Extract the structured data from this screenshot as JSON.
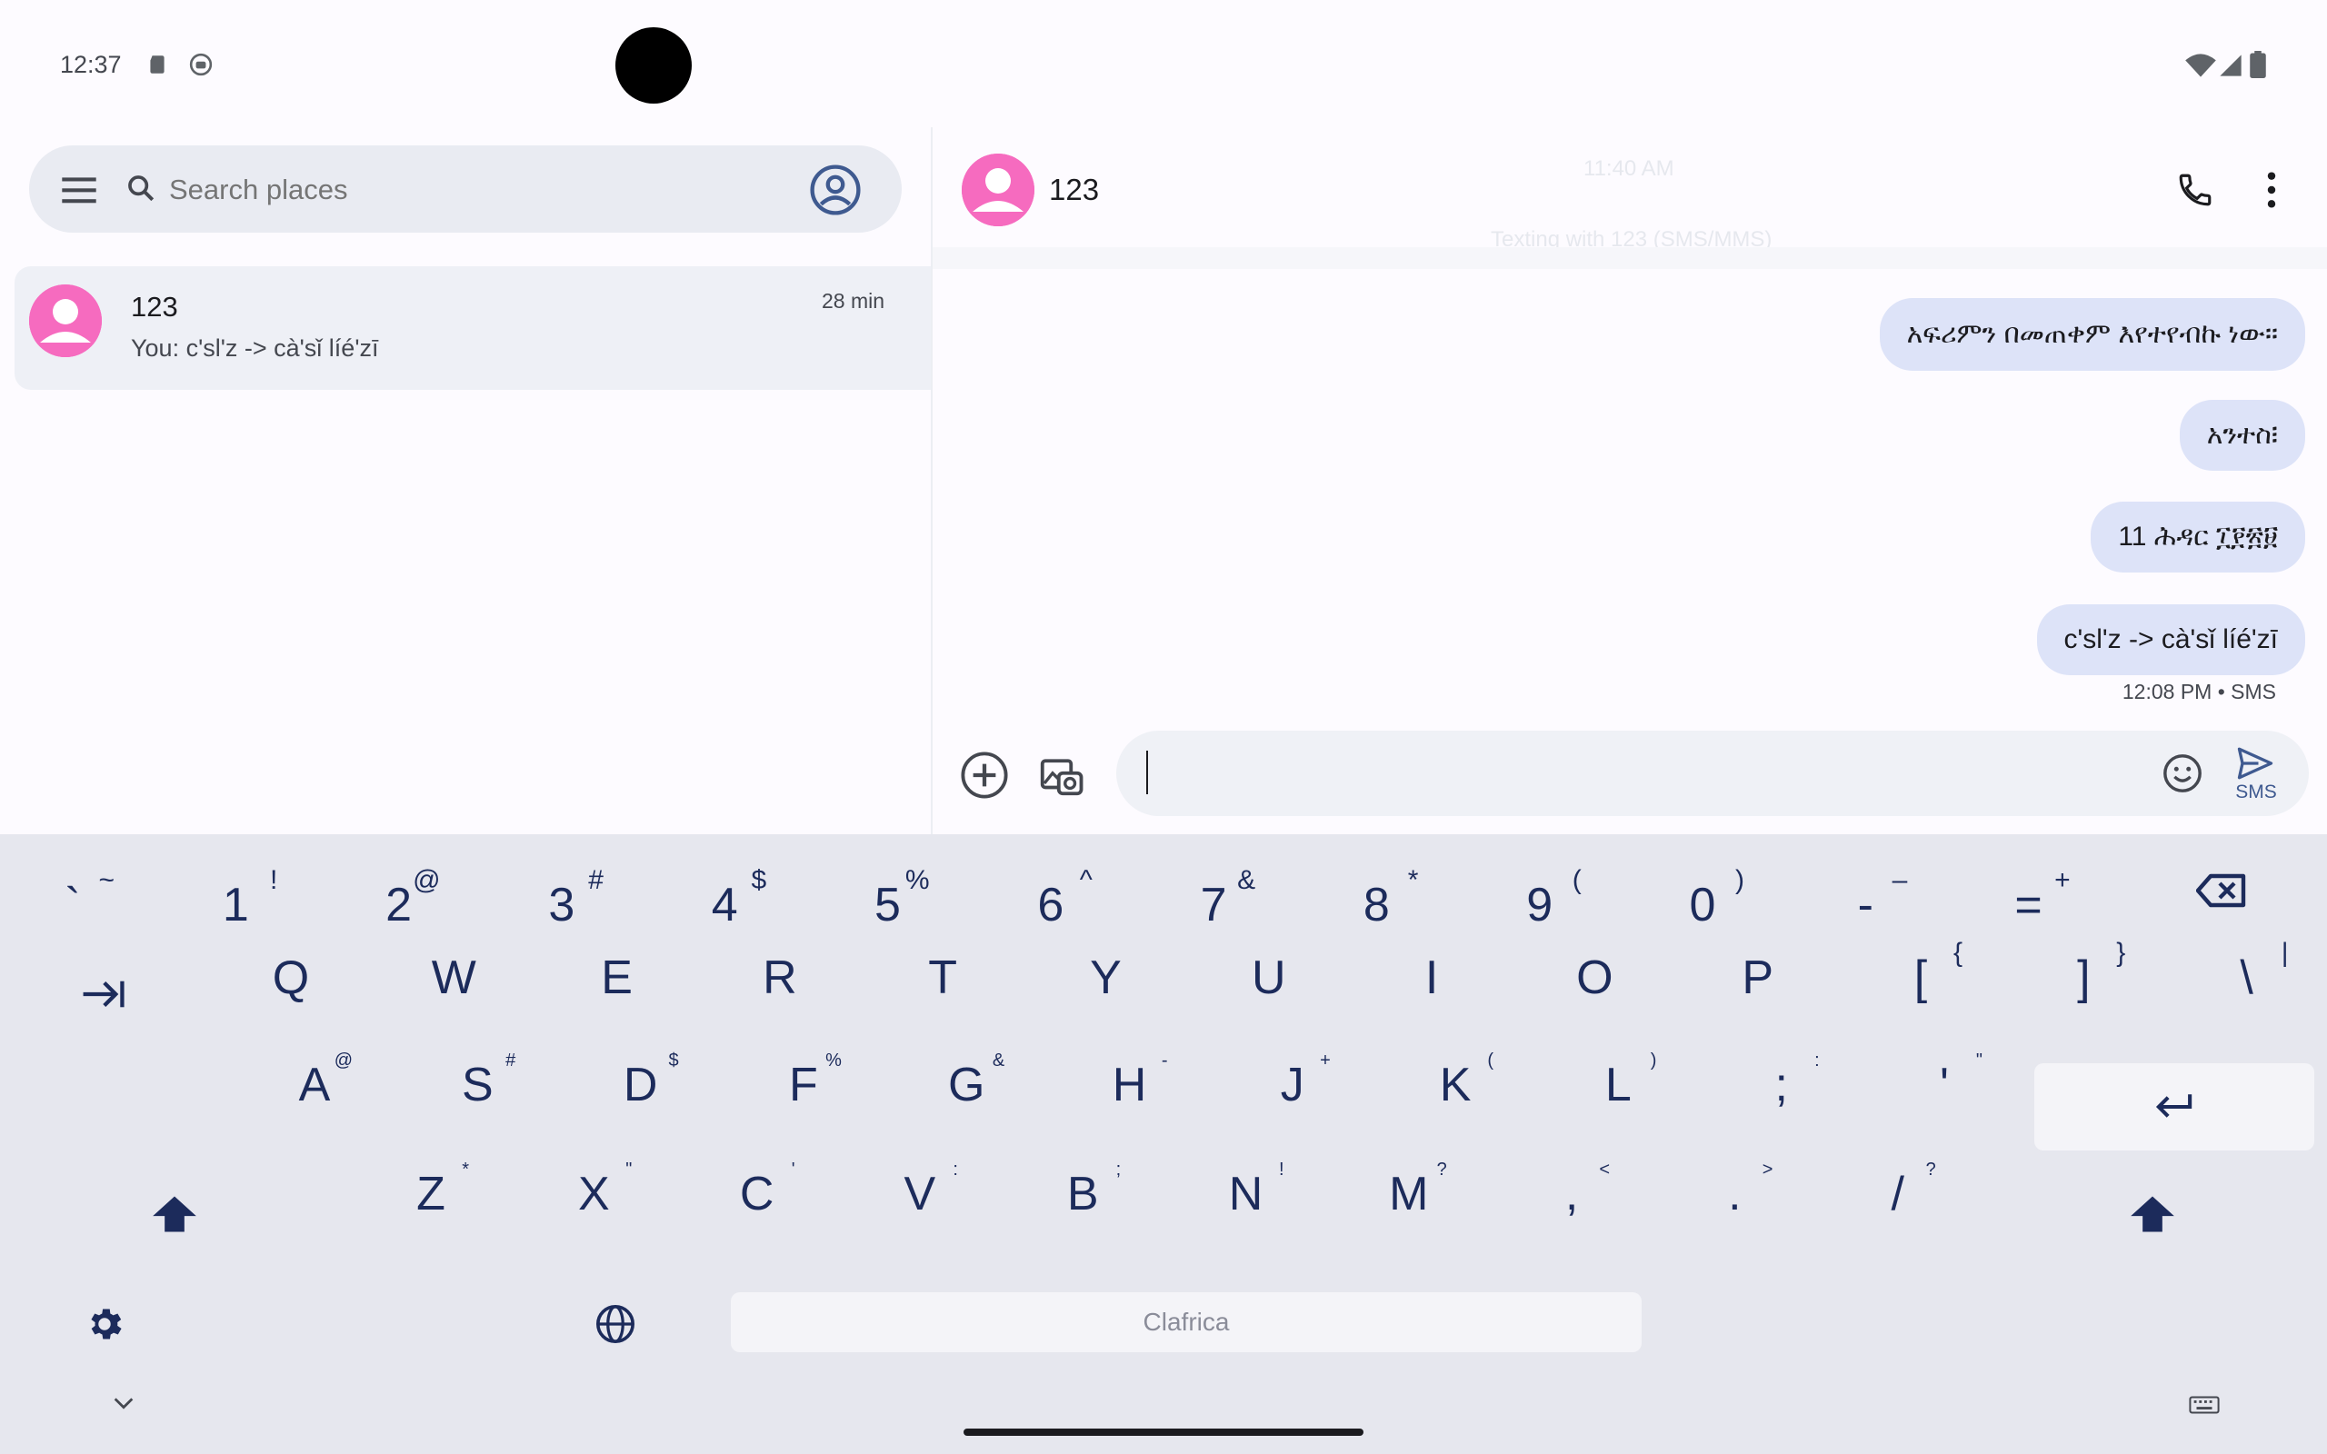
{
  "status_bar": {
    "time": "12:37"
  },
  "search": {
    "placeholder": "Search places"
  },
  "conversations": [
    {
      "name": "123",
      "time": "28 min",
      "snippet": "You: c'sl'z -> cà'sǐ líé'zī"
    }
  ],
  "chat": {
    "contact_name": "123",
    "faint_time": "11:40 AM",
    "faint_info": "Texting with 123 (SMS/MMS)",
    "messages": [
      {
        "text": "አፍሪምን በመጠቀም እየተየብኩ ነው።"
      },
      {
        "text": "አንተስ፧"
      },
      {
        "text": "11 ሕዳር ፲፻፳፱"
      },
      {
        "text": "c'sl'z -> cà'sǐ líé'zī"
      }
    ],
    "last_meta": "12:08 PM • SMS",
    "send_label": "SMS"
  },
  "keyboard": {
    "space_label": "Clafrica",
    "row1": [
      {
        "main": "`",
        "sup": "~"
      },
      {
        "main": "1",
        "sup": "!"
      },
      {
        "main": "2",
        "sup": "@"
      },
      {
        "main": "3",
        "sup": "#"
      },
      {
        "main": "4",
        "sup": "$"
      },
      {
        "main": "5",
        "sup": "%"
      },
      {
        "main": "6",
        "sup": "^"
      },
      {
        "main": "7",
        "sup": "&"
      },
      {
        "main": "8",
        "sup": "*"
      },
      {
        "main": "9",
        "sup": "("
      },
      {
        "main": "0",
        "sup": ")"
      },
      {
        "main": "-",
        "sup": "–"
      },
      {
        "main": "=",
        "sup": "+"
      }
    ],
    "row2": [
      {
        "main": "Q"
      },
      {
        "main": "W"
      },
      {
        "main": "E"
      },
      {
        "main": "R"
      },
      {
        "main": "T"
      },
      {
        "main": "Y"
      },
      {
        "main": "U"
      },
      {
        "main": "I"
      },
      {
        "main": "O"
      },
      {
        "main": "P"
      },
      {
        "main": "[",
        "sup": "{"
      },
      {
        "main": "]",
        "sup": "}"
      },
      {
        "main": "\\",
        "sup": "|"
      }
    ],
    "row3": [
      {
        "main": "A",
        "sup": "@"
      },
      {
        "main": "S",
        "sup": "#"
      },
      {
        "main": "D",
        "sup": "$"
      },
      {
        "main": "F",
        "sup": "%"
      },
      {
        "main": "G",
        "sup": "&"
      },
      {
        "main": "H",
        "sup": "-"
      },
      {
        "main": "J",
        "sup": "+"
      },
      {
        "main": "K",
        "sup": "("
      },
      {
        "main": "L",
        "sup": ")"
      },
      {
        "main": ";",
        "sup": ":"
      },
      {
        "main": "'",
        "sup": "\""
      }
    ],
    "row4": [
      {
        "main": "Z",
        "sup": "*"
      },
      {
        "main": "X",
        "sup": "\""
      },
      {
        "main": "C",
        "sup": "'"
      },
      {
        "main": "V",
        "sup": ":"
      },
      {
        "main": "B",
        "sup": ";"
      },
      {
        "main": "N",
        "sup": "!"
      },
      {
        "main": "M",
        "sup": "?"
      },
      {
        "main": ",",
        "sup": "<"
      },
      {
        "main": ".",
        "sup": ">"
      },
      {
        "main": "/",
        "sup": "?"
      }
    ]
  }
}
